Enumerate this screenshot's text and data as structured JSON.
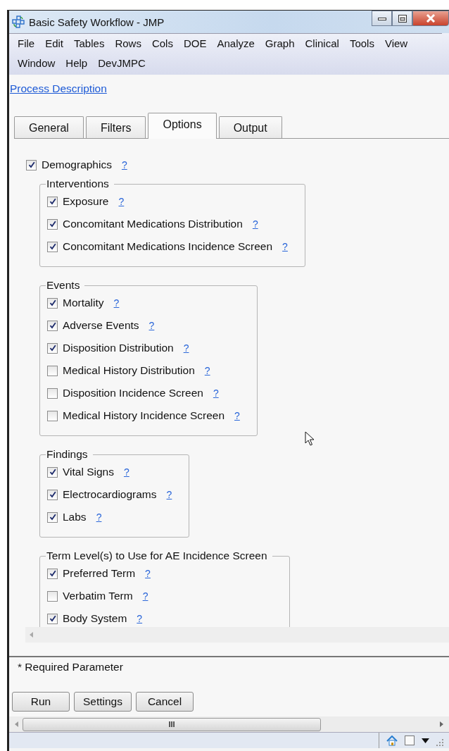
{
  "window": {
    "title": "Basic Safety Workflow - JMP"
  },
  "menu": [
    {
      "label": "File"
    },
    {
      "label": "Edit"
    },
    {
      "label": "Tables"
    },
    {
      "label": "Rows"
    },
    {
      "label": "Cols"
    },
    {
      "label": "DOE"
    },
    {
      "label": "Analyze"
    },
    {
      "label": "Graph"
    },
    {
      "label": "Clinical"
    },
    {
      "label": "Tools"
    },
    {
      "label": "View"
    },
    {
      "label": "Window"
    },
    {
      "label": "Help"
    },
    {
      "label": "DevJMPC"
    }
  ],
  "link": "Process Description",
  "tabs": [
    {
      "label": "General",
      "selected": false
    },
    {
      "label": "Filters",
      "selected": false
    },
    {
      "label": "Options",
      "selected": true
    },
    {
      "label": "Output",
      "selected": false
    }
  ],
  "options": {
    "top": {
      "label": "Demographics",
      "checked": true,
      "help": "?"
    },
    "groups": [
      {
        "title": "Interventions",
        "items": [
          {
            "label": "Exposure",
            "checked": true,
            "help": "?"
          },
          {
            "label": "Concomitant Medications Distribution",
            "checked": true,
            "help": "?"
          },
          {
            "label": "Concomitant Medications Incidence Screen",
            "checked": true,
            "help": "?"
          }
        ]
      },
      {
        "title": "Events",
        "items": [
          {
            "label": "Mortality",
            "checked": true,
            "help": "?"
          },
          {
            "label": "Adverse Events",
            "checked": true,
            "help": "?"
          },
          {
            "label": "Disposition Distribution",
            "checked": true,
            "help": "?"
          },
          {
            "label": "Medical History Distribution",
            "checked": false,
            "help": "?"
          },
          {
            "label": "Disposition Incidence Screen",
            "checked": false,
            "help": "?"
          },
          {
            "label": "Medical History Incidence Screen",
            "checked": false,
            "help": "?"
          }
        ]
      },
      {
        "title": "Findings",
        "items": [
          {
            "label": "Vital Signs",
            "checked": true,
            "help": "?"
          },
          {
            "label": "Electrocardiograms",
            "checked": true,
            "help": "?"
          },
          {
            "label": "Labs",
            "checked": true,
            "help": "?"
          }
        ]
      },
      {
        "title": "Term Level(s) to Use for AE Incidence Screen",
        "items": [
          {
            "label": "Preferred Term",
            "checked": true,
            "help": "?"
          },
          {
            "label": "Verbatim Term",
            "checked": false,
            "help": "?"
          },
          {
            "label": "Body System",
            "checked": true,
            "help": "?"
          }
        ]
      }
    ]
  },
  "required_note": "* Required Parameter",
  "buttons": [
    {
      "label": "Run"
    },
    {
      "label": "Settings"
    },
    {
      "label": "Cancel"
    }
  ],
  "scrollbar_grip": "III"
}
